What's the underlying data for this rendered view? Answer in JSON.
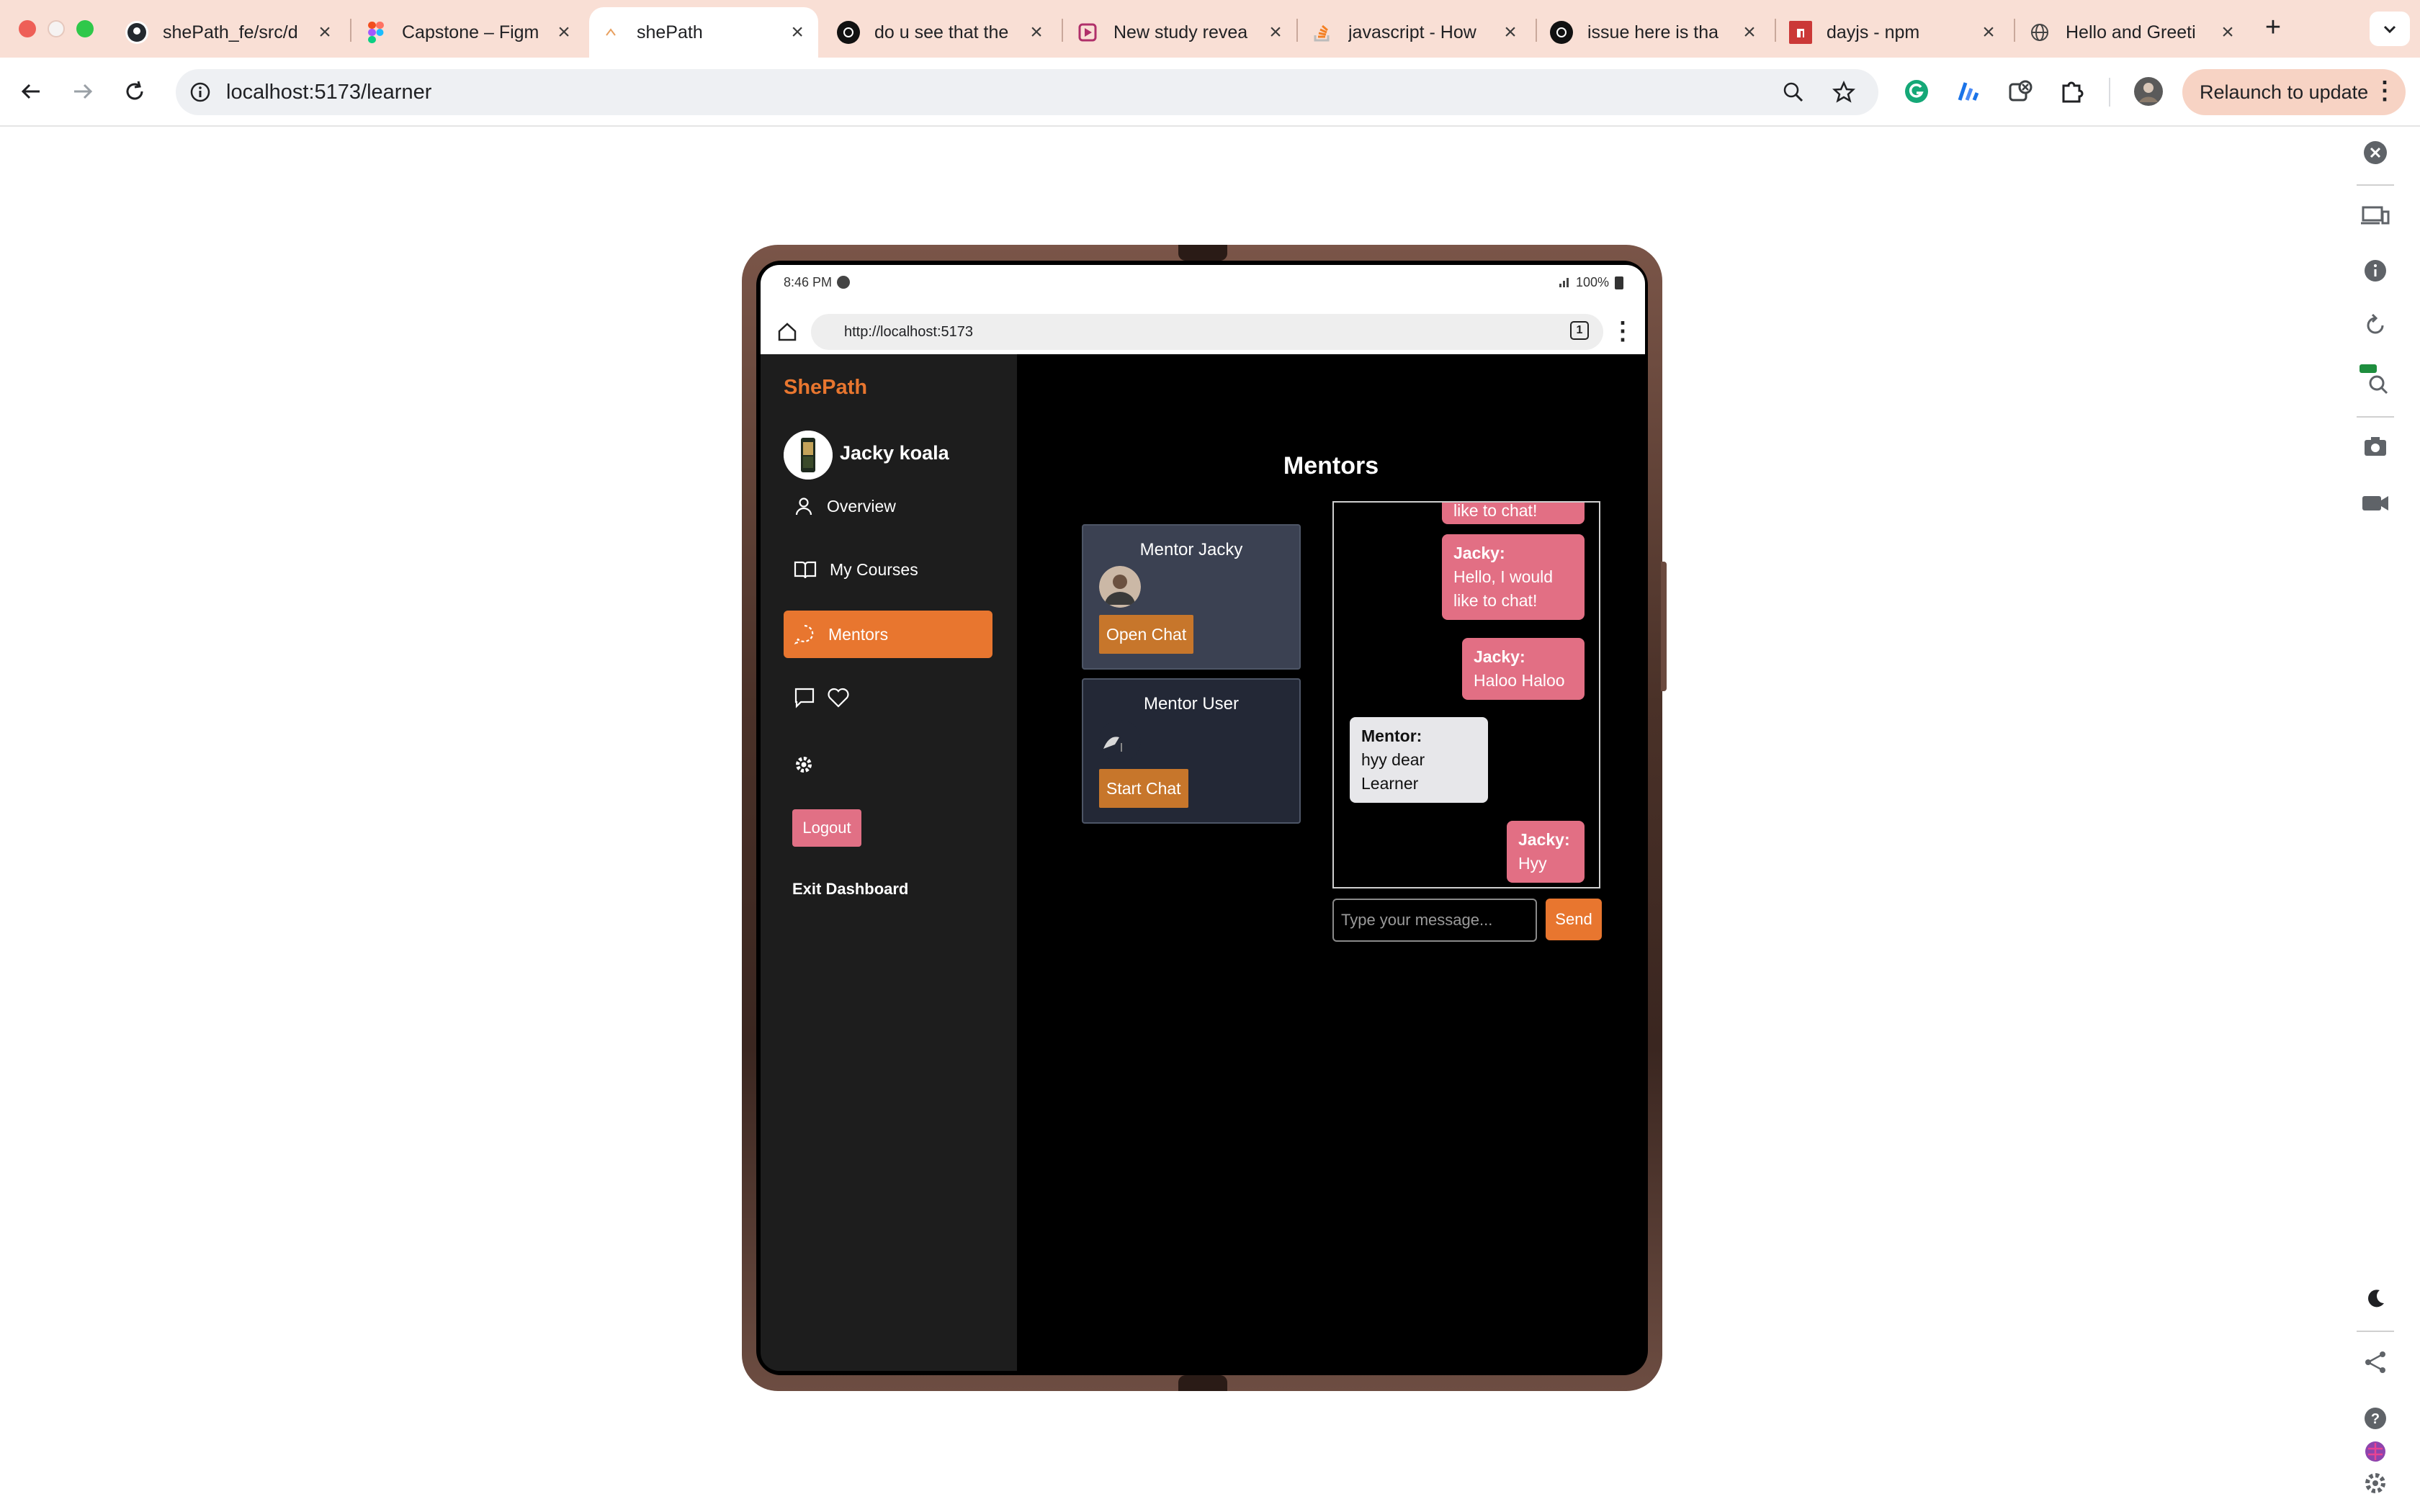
{
  "browser": {
    "tabs": [
      {
        "title": "shePath_fe/src/d",
        "favicon": "github-icon"
      },
      {
        "title": "Capstone – Figm",
        "favicon": "figma-icon"
      },
      {
        "title": "shePath",
        "favicon": "shepath-icon",
        "active": true
      },
      {
        "title": "do u see that the",
        "favicon": "chatgpt-icon"
      },
      {
        "title": "New study revea",
        "favicon": "perplexity-icon"
      },
      {
        "title": "javascript - How",
        "favicon": "stackoverflow-icon"
      },
      {
        "title": "issue here is tha",
        "favicon": "chatgpt-icon"
      },
      {
        "title": "dayjs - npm",
        "favicon": "npm-icon"
      },
      {
        "title": "Hello and Greeti",
        "favicon": "globe-icon"
      }
    ],
    "url": "localhost:5173/learner",
    "relaunch_label": "Relaunch to update"
  },
  "device": {
    "time": "8:46 PM",
    "battery": "100%",
    "mobile_url": "http://localhost:5173",
    "tab_count": "1"
  },
  "app": {
    "brand": "ShePath",
    "user_name": "Jacky koala",
    "nav": [
      {
        "label": "Overview",
        "icon": "user-icon"
      },
      {
        "label": "My Courses",
        "icon": "book-icon"
      },
      {
        "label": "Mentors",
        "icon": "chat-bubble-icon",
        "active": true
      }
    ],
    "logout_label": "Logout",
    "exit_label": "Exit Dashboard",
    "page_title": "Mentors",
    "mentors": [
      {
        "name": "Mentor Jacky",
        "button": "Open Chat"
      },
      {
        "name": "Mentor User",
        "button": "Start Chat"
      }
    ],
    "chat": {
      "messages": [
        {
          "sender": "Jacky:",
          "text": "like to chat!",
          "role": "user"
        },
        {
          "sender": "Jacky:",
          "text": "Hello, I would like to chat!",
          "role": "user"
        },
        {
          "sender": "Jacky:",
          "text": "Haloo Haloo",
          "role": "user"
        },
        {
          "sender": "Mentor:",
          "text": "hyy dear Learner",
          "role": "mentor"
        },
        {
          "sender": "Jacky:",
          "text": "Hyy",
          "role": "user"
        }
      ],
      "placeholder": "Type your message...",
      "send_label": "Send"
    },
    "colors": {
      "accent": "#e8762f",
      "user_bubble": "#e26f84",
      "mentor_bubble": "#e7e7ea",
      "sidebar": "#1d1d1d"
    }
  }
}
